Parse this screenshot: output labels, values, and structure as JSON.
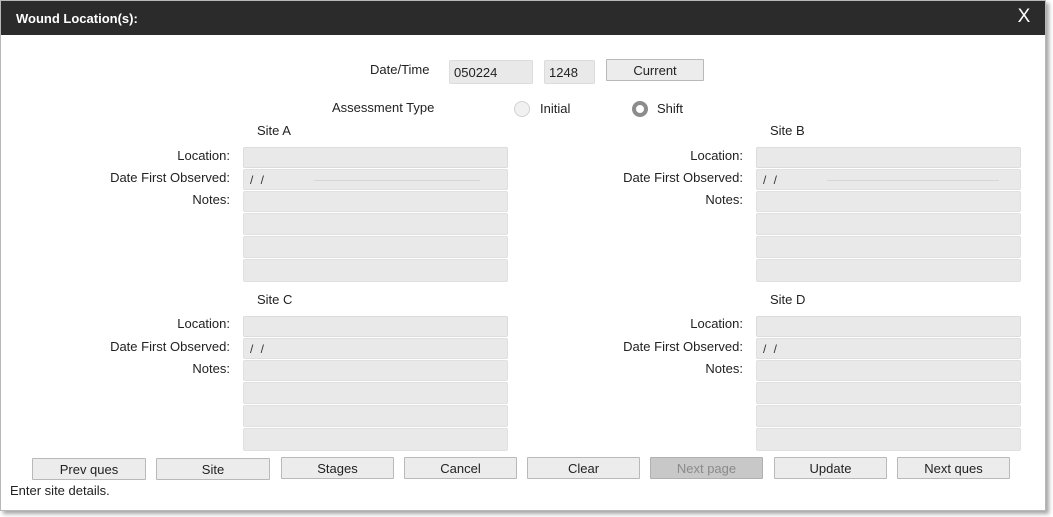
{
  "window": {
    "title": "Wound Location(s):",
    "close_label": "X"
  },
  "datetime": {
    "label": "Date/Time",
    "date_value": "050224",
    "time_value": "1248",
    "current_button": "Current"
  },
  "assessment": {
    "label": "Assessment Type",
    "options": [
      {
        "label": "Initial",
        "selected": false
      },
      {
        "label": "Shift",
        "selected": true
      }
    ]
  },
  "field_labels": {
    "location": "Location:",
    "date_first_observed": "Date First Observed:",
    "notes": "Notes:"
  },
  "sites": [
    {
      "title": "Site A",
      "location": "",
      "date_first_observed": " / /"
    },
    {
      "title": "Site B",
      "location": "",
      "date_first_observed": " / /"
    },
    {
      "title": "Site C",
      "location": "",
      "date_first_observed": " / /"
    },
    {
      "title": "Site D",
      "location": "",
      "date_first_observed": " / /"
    }
  ],
  "buttons": {
    "prev_ques": "Prev ques",
    "site": "Site",
    "stages": "Stages",
    "cancel": "Cancel",
    "clear": "Clear",
    "next_page": "Next page",
    "update": "Update",
    "next_ques": "Next ques"
  },
  "status_text": "Enter site details."
}
